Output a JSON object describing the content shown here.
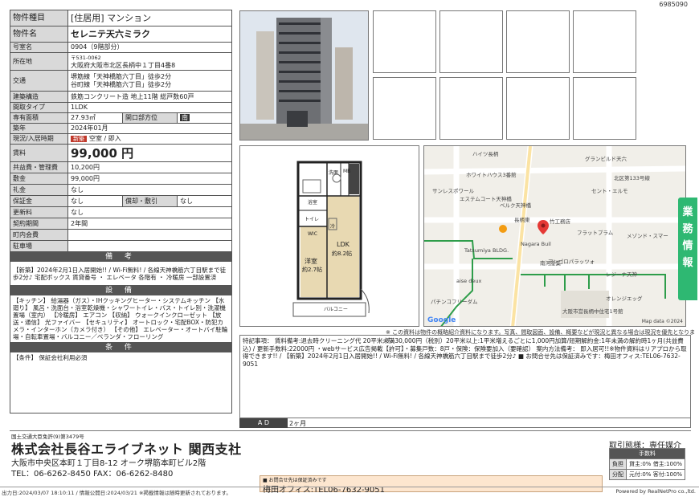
{
  "doc_id": "6985090",
  "rows": {
    "type_label": "物件種目",
    "type_value": "[住居用]  マンション",
    "name_label": "物件名",
    "name_value": "セレニテ天六ミラク",
    "room_label": "号室名",
    "room_value": "0904（9階部分）",
    "addr_label": "所在地",
    "addr_zip": "〒531-0062",
    "addr_value": "大阪府大阪市北区長柄中１丁目4番8",
    "traffic_label": "交通",
    "traffic_1": "堺筋線「天神橋筋六丁目」徒歩2分",
    "traffic_2": "谷町線「天神橋筋六丁目」徒歩2分",
    "struct_label": "建築構造",
    "struct_value": "鉄筋コンクリート造 地上11階 総戸数60戸",
    "layout_label": "間取タイプ",
    "layout_value": "1LDK",
    "area_label": "専有面積",
    "area_value": "27.93㎡",
    "dir_label": "開口部方位",
    "dir_value": "南",
    "built_label": "築年",
    "built_value": "2024年01月",
    "status_label": "現況/入居時期",
    "status_badge": "新築",
    "status_value": "空室 / 即入",
    "rent_label": "賃料",
    "rent_value": "99,000 円",
    "fee_label": "共益費・管理費",
    "fee_value": "10,200円",
    "deposit_label": "敷金",
    "deposit_value": "99,000円",
    "key_label": "礼金",
    "key_value": "なし",
    "guarantee_label": "保証金",
    "guarantee_value": "なし",
    "amort_label": "償却・敷引",
    "amort_value": "なし",
    "renew_label": "更新料",
    "renew_value": "なし",
    "contract_label": "契約期間",
    "contract_value": "2年間",
    "town_label": "町内会費",
    "town_value": "",
    "parking_label": "駐車場",
    "parking_value": ""
  },
  "sections": {
    "notes_title": "備 考",
    "notes_text": "【新築】2024年2月1日入居開始!! / Wi-Fi無料! / 各線天神橋筋六丁目駅まで徒歩2分♪ 宅配ボックス 賃貸番号 ・ エレベータ 各階有 ・ 冷暖房 一部設置済",
    "equip_title": "設 備",
    "equip_text": "【キッチン】 給湯器（ガス）・IHクッキングヒーター・システムキッチン 【水廻り】 風呂・洗面台・浴室乾燥機・シャワートイレ・バス・トイレ別・洗濯機置場（室内） 【冷暖房】 エアコン 【収納】 ウォークインクローゼット 【放送・通信】 光ファイバー 【セキュリティ】 オートロック・宅配BOX・防犯カメラ・インターホン（カメラ付き） 【その他】 エレベーター・オートバイ駐輪場・自転車置場・バルコニー／ベランダ・フローリング",
    "cond_title": "条 件",
    "cond_text": "【条件】 保証会社利用必須"
  },
  "floorplan": {
    "washroom": "洗面",
    "bath": "浴室",
    "toilet": "トイレ",
    "mb": "MB",
    "closet": "WIC",
    "bedroom": "洋室",
    "bedroom_size": "約2.7帖",
    "ldk": "LDK",
    "ldk_size": "約8.2帖",
    "balcony": "バルコニー",
    "fridge": "冷"
  },
  "map": {
    "labels": [
      "ハイツ長柄",
      "グランビルド天六",
      "ホワイトハウス3番館",
      "北区第133号線",
      "サンレスポワール",
      "エステムコート天神橋",
      "セント・エルモ",
      "ベルク天神橋",
      "長柄東",
      "竹工務店",
      "フラットプラム",
      "Nagara Buil",
      "メゾンド・スマー",
      "Tatsumiya BLDG.",
      "南河産業",
      "アンゴロパラッツォ",
      "レジーナ天神",
      "aise deux",
      "パチンコフリーダム",
      "オレンジエッグ",
      "大阪市営長柄中住宅1号館"
    ],
    "attribution": "Map data ©2024",
    "google": "Google"
  },
  "notice": "※ この資料は物件の概略紹介資料になります。写真、間取図面、設備、概要などが現況と異なる場合は現況を優先となります。",
  "special_remarks": "特記事項： 賃料備考:退去時クリーニング代 20平米未満30,000円（税別）20平米以上:1平米増えるごとに1,000円加算/短期解約金:1年未満の解約時1ヶ月(共益費込) / 更新手数料:22000円 ・webサービス広告掲載【許可】・募集戸数：8戸・保険：保険要加入（要確認） 案内方法備考： 即入居可!!※物件資料はリアプロから取得できます!! / 【新築】2024年2月1日入居開始!! / Wi-Fi無料! / 各線天神橋筋六丁目駅まで徒歩2分♪ ■ お問合せ先は保証済みです：梅田オフィス:TEL06-7632-9051",
  "ad": {
    "label": "A D",
    "value": "2ヶ月"
  },
  "side_tab": [
    "業",
    "務",
    "情",
    "報"
  ],
  "footer": {
    "license": "国土交通大臣免許(9)第3479号",
    "company": "株式会社長谷エライブネット 関西支社",
    "address": "大阪市中央区本町１丁目8-12 オーク堺筋本町ビル2階",
    "tel": "TEL：06-6262-8450  FAX：06-6262-8480",
    "torihiki": "取引態様：専任媒介",
    "fee_head": "手数料",
    "fee_rows": [
      [
        "負担",
        "貸主:0% 借主:100%"
      ],
      [
        "分配",
        "元付:0% 客付:100%"
      ]
    ],
    "contact_small": "■ お問合せ先は保証済みです",
    "contact_main": "梅田オフィス:TEL06-7632-9051",
    "output": "出力日:2024/03/07 18:10:11 / 情報公開日:2024/03/21 ※掲載情報は随時更新されております。",
    "powered": "Powered by RealNetPro co.,ltd."
  },
  "colors": {
    "label_bg": "#d9d9d9",
    "section_bg": "#555555",
    "new_badge": "#c0392b",
    "side_tab": "#2eb872",
    "contact_bg": "#fde6cf"
  }
}
